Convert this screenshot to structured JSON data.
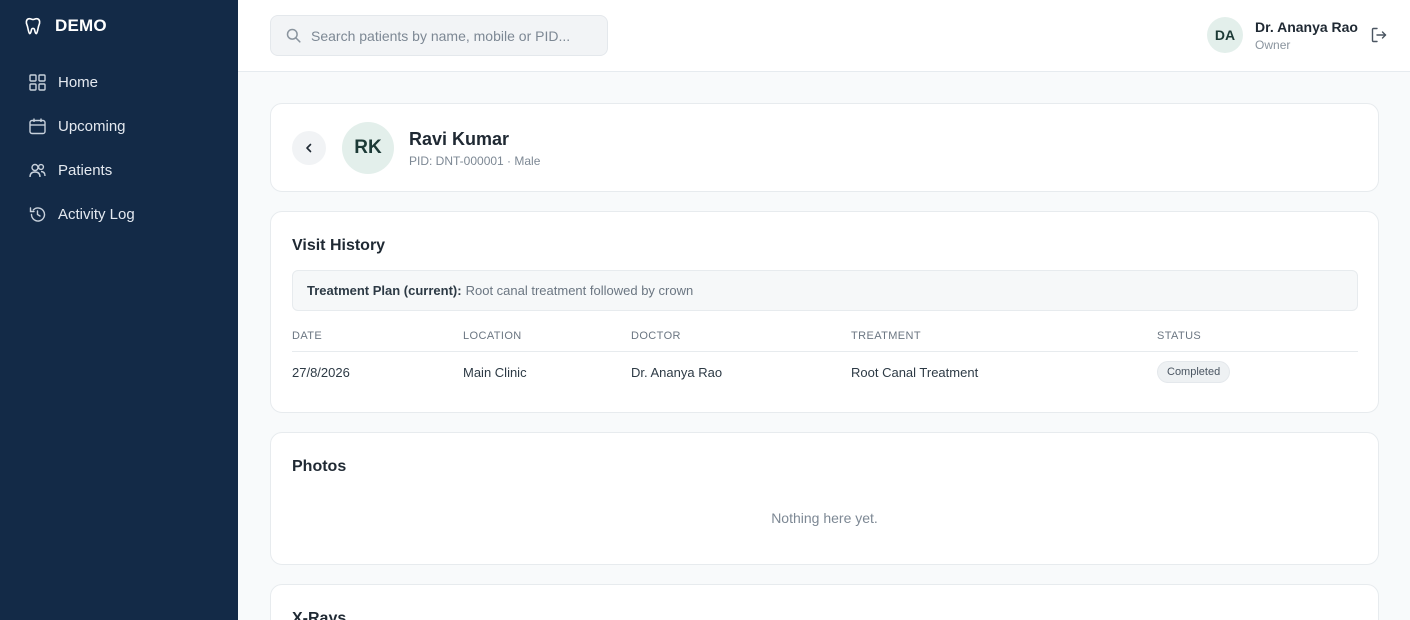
{
  "brand": {
    "name": "DEMO",
    "icon": "tooth-icon"
  },
  "sidebar": {
    "items": [
      {
        "label": "Home",
        "icon": "grid-icon"
      },
      {
        "label": "Upcoming",
        "icon": "calendar-icon"
      },
      {
        "label": "Patients",
        "icon": "users-icon"
      },
      {
        "label": "Activity Log",
        "icon": "history-icon"
      }
    ]
  },
  "search": {
    "placeholder": "Search patients by name, mobile or PID..."
  },
  "user": {
    "initials": "DA",
    "name": "Dr. Ananya Rao",
    "role": "Owner"
  },
  "patient": {
    "initials": "RK",
    "name": "Ravi Kumar",
    "meta": "PID: DNT-000001 · Male"
  },
  "visit_history": {
    "title": "Visit History",
    "plan_label": "Treatment Plan (current):",
    "plan_value": "Root canal treatment followed by crown",
    "columns": [
      "DATE",
      "LOCATION",
      "DOCTOR",
      "TREATMENT",
      "STATUS"
    ],
    "rows": [
      {
        "date": "27/8/2026",
        "location": "Main Clinic",
        "doctor": "Dr. Ananya Rao",
        "treatment": "Root Canal Treatment",
        "status": "Completed"
      }
    ]
  },
  "photos": {
    "title": "Photos",
    "empty": "Nothing here yet."
  },
  "xrays": {
    "title": "X-Rays"
  },
  "colors": {
    "sidebar_bg": "#132a47",
    "avatar_bg": "#e3efeb",
    "page_bg": "#f8fafb"
  }
}
